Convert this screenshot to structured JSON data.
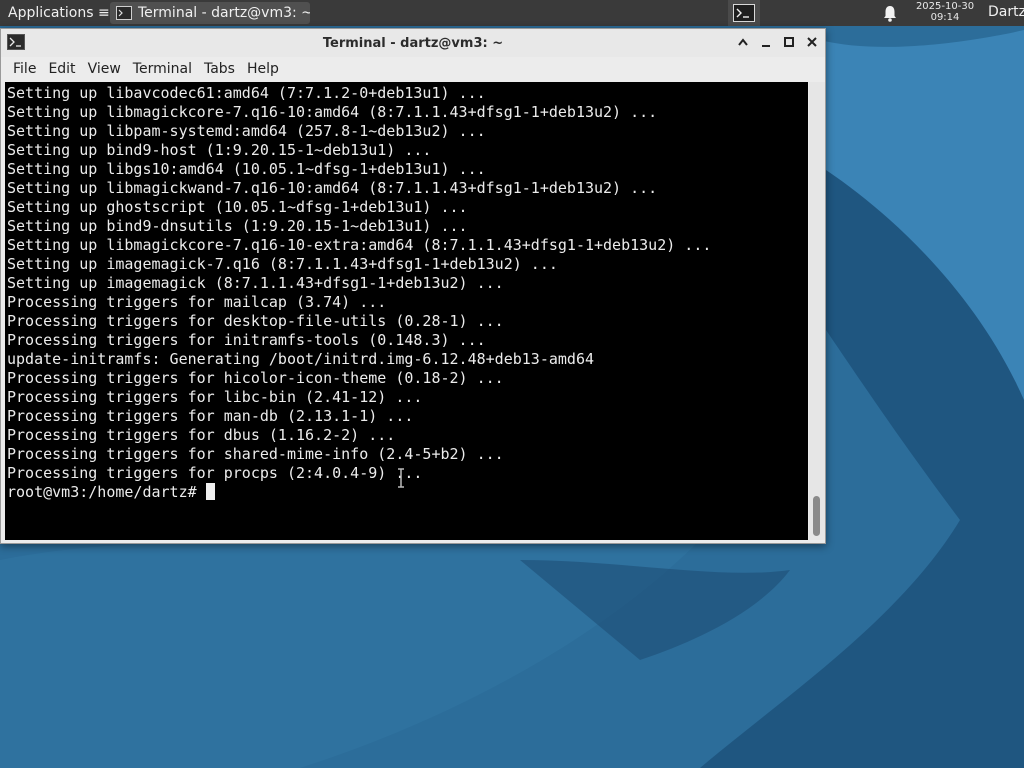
{
  "panel": {
    "apps_label": "Applications ≡",
    "task_label": "Terminal - dartz@vm3: ~",
    "clock_date": "2025-10-30",
    "clock_time": "09:14",
    "user": "Dartz",
    "icons": [
      "apps-icon",
      "terminal-icon",
      "terminal-launcher-icon",
      "bell-icon"
    ]
  },
  "window": {
    "title": "Terminal - dartz@vm3: ~",
    "controls": [
      "chevron-up-icon",
      "minimize-icon",
      "maximize-icon",
      "close-icon"
    ]
  },
  "menu": {
    "file": "File",
    "edit": "Edit",
    "view": "View",
    "terminal": "Terminal",
    "tabs": "Tabs",
    "help": "Help"
  },
  "terminal": {
    "lines": [
      "Setting up libavcodec61:amd64 (7:7.1.2-0+deb13u1) ...",
      "Setting up libmagickcore-7.q16-10:amd64 (8:7.1.1.43+dfsg1-1+deb13u2) ...",
      "Setting up libpam-systemd:amd64 (257.8-1~deb13u2) ...",
      "Setting up bind9-host (1:9.20.15-1~deb13u1) ...",
      "Setting up libgs10:amd64 (10.05.1~dfsg-1+deb13u1) ...",
      "Setting up libmagickwand-7.q16-10:amd64 (8:7.1.1.43+dfsg1-1+deb13u2) ...",
      "Setting up ghostscript (10.05.1~dfsg-1+deb13u1) ...",
      "Setting up bind9-dnsutils (1:9.20.15-1~deb13u1) ...",
      "Setting up libmagickcore-7.q16-10-extra:amd64 (8:7.1.1.43+dfsg1-1+deb13u2) ...",
      "Setting up imagemagick-7.q16 (8:7.1.1.43+dfsg1-1+deb13u2) ...",
      "Setting up imagemagick (8:7.1.1.43+dfsg1-1+deb13u2) ...",
      "Processing triggers for mailcap (3.74) ...",
      "Processing triggers for desktop-file-utils (0.28-1) ...",
      "Processing triggers for initramfs-tools (0.148.3) ...",
      "update-initramfs: Generating /boot/initrd.img-6.12.48+deb13-amd64",
      "Processing triggers for hicolor-icon-theme (0.18-2) ...",
      "Processing triggers for libc-bin (2.41-12) ...",
      "Processing triggers for man-db (2.13.1-1) ...",
      "Processing triggers for dbus (1.16.2-2) ...",
      "Processing triggers for shared-mime-info (2.4-5+b2) ...",
      "Processing triggers for procps (2:4.0.4-9) ..."
    ],
    "prompt": "root@vm3:/home/dartz#"
  },
  "colors": {
    "panel_bg": "#3a3a3a",
    "terminal_bg": "#000000",
    "terminal_fg": "#ececec",
    "desktop_bg": "#2a6a98"
  }
}
